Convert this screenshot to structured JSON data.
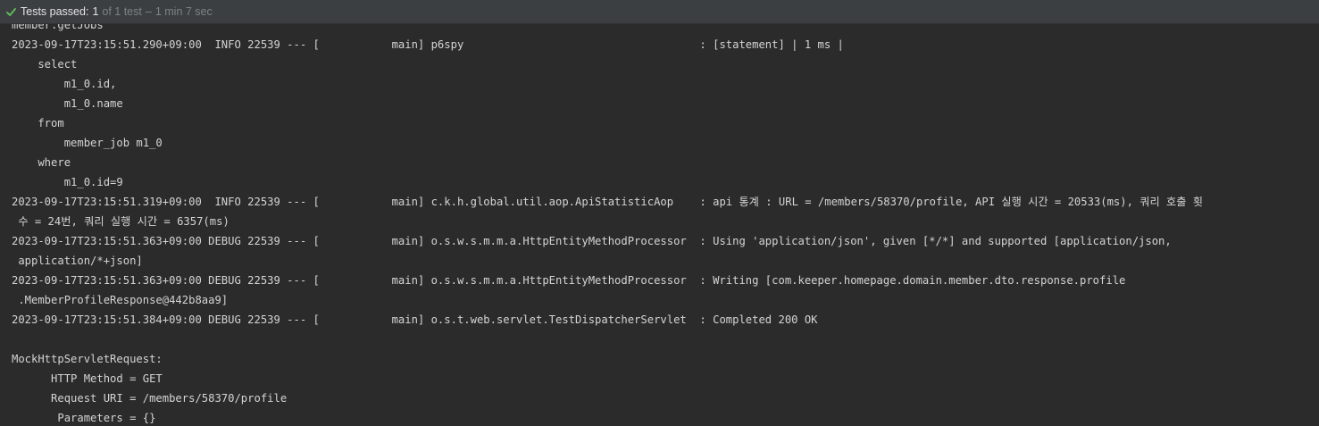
{
  "status": {
    "label": "Tests passed:",
    "count": "1",
    "detail": "of 1 test",
    "sep": "–",
    "time": "1 min 7 sec",
    "accent": "#5fb85b"
  },
  "console": {
    "lines": [
      "member.getJobs",
      "2023-09-17T23:15:51.290+09:00  INFO 22539 --- [           main] p6spy                                    : [statement] | 1 ms |",
      "    select",
      "        m1_0.id,",
      "        m1_0.name",
      "    from",
      "        member_job m1_0",
      "    where",
      "        m1_0.id=9",
      "2023-09-17T23:15:51.319+09:00  INFO 22539 --- [           main] c.k.h.global.util.aop.ApiStatisticAop    : api 통계 : URL = /members/58370/profile, API 실행 시간 = 20533(ms), 쿼리 호출 횟",
      " 수 = 24번, 쿼리 실행 시간 = 6357(ms)",
      "2023-09-17T23:15:51.363+09:00 DEBUG 22539 --- [           main] o.s.w.s.m.m.a.HttpEntityMethodProcessor  : Using 'application/json', given [*/*] and supported [application/json,",
      " application/*+json]",
      "2023-09-17T23:15:51.363+09:00 DEBUG 22539 --- [           main] o.s.w.s.m.m.a.HttpEntityMethodProcessor  : Writing [com.keeper.homepage.domain.member.dto.response.profile",
      " .MemberProfileResponse@442b8aa9]",
      "2023-09-17T23:15:51.384+09:00 DEBUG 22539 --- [           main] o.s.t.web.servlet.TestDispatcherServlet  : Completed 200 OK",
      "",
      "MockHttpServletRequest:",
      "      HTTP Method = GET",
      "      Request URI = /members/58370/profile",
      "       Parameters = {}"
    ]
  }
}
